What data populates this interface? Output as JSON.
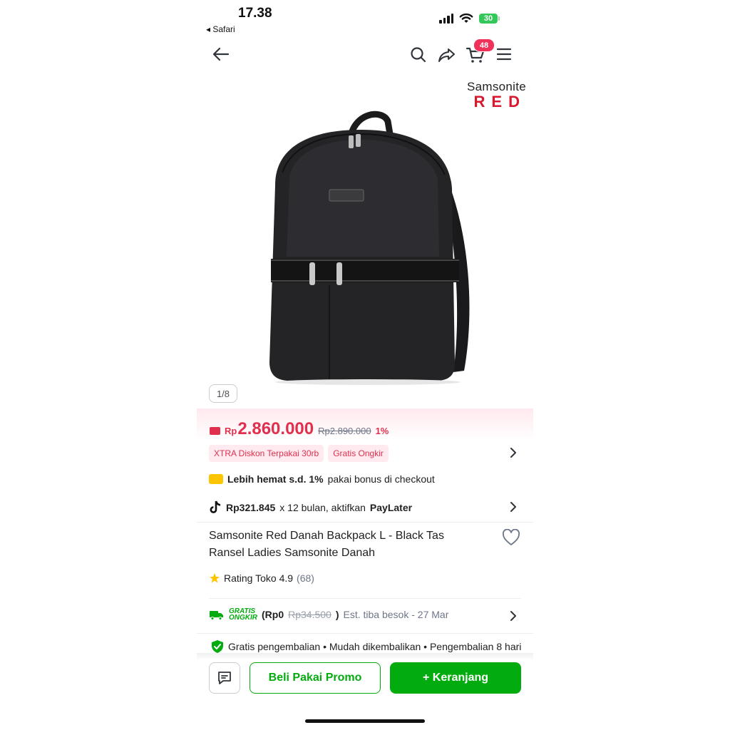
{
  "status_bar": {
    "time": "17.38",
    "back_app": "◂ Safari",
    "battery": "30"
  },
  "nav": {
    "cart_count": "48"
  },
  "brand": {
    "line1": "Samsonite",
    "line2": "RED"
  },
  "gallery": {
    "counter": "1/8"
  },
  "pricing": {
    "currency": "Rp",
    "price": "2.860.000",
    "original_price": "Rp2.890.000",
    "discount": "1%"
  },
  "badges": [
    "XTRA Diskon Terpakai 30rb",
    "Gratis Ongkir"
  ],
  "savings": {
    "bold": "Lebih hemat s.d. 1%",
    "rest": "pakai bonus di checkout"
  },
  "paylater": {
    "amount": "Rp321.845",
    "middle": "x 12 bulan, aktifkan",
    "label": "PayLater"
  },
  "product": {
    "title": "Samsonite Red Danah Backpack L - Black Tas Ransel Ladies Samsonite Danah"
  },
  "rating": {
    "text": "Rating Toko 4.9",
    "count": "(68)"
  },
  "shipping": {
    "gratis_line1": "GRATIS",
    "gratis_line2": "ONGKIR",
    "price_open": "(Rp0",
    "strike": "Rp34.500",
    "close": ")",
    "estimate": "Est. tiba besok - 27 Mar"
  },
  "returns": {
    "text": "Gratis pengembalian • Mudah dikembalikan • Pengembalian 8 hari"
  },
  "actions": {
    "promo_label": "Beli Pakai Promo",
    "cart_label": "+ Keranjang"
  },
  "colors": {
    "accent_green": "#03ac0e",
    "price_red": "#e0304d",
    "badge_pink": "#f0325a"
  }
}
